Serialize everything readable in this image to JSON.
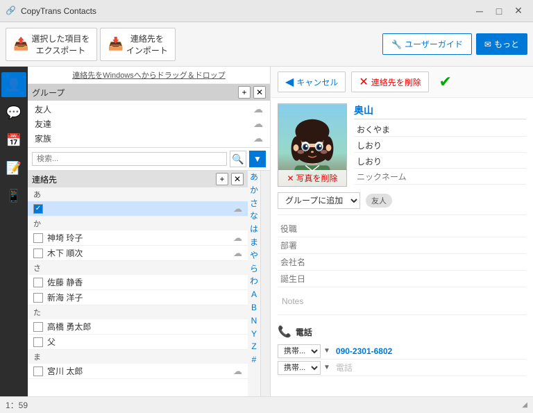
{
  "app": {
    "title": "CopyTrans Contacts",
    "window_controls": {
      "minimize": "─",
      "maximize": "□",
      "close": "✕"
    }
  },
  "toolbar": {
    "export_icon": "📤",
    "export_label_line1": "選択した項目を",
    "export_label_line2": "エクスポート",
    "import_icon": "📥",
    "import_label_line1": "連絡先を",
    "import_label_line2": "インポート",
    "guide_icon": "🔧",
    "guide_label": "ユーザーガイド",
    "more_icon": "✉",
    "more_label": "もっと"
  },
  "drag_hint": "連絡先をWindowsへからドラッグ＆ドロップ",
  "groups": {
    "header": "グループ",
    "add_btn": "+",
    "remove_btn": "✕",
    "items": [
      {
        "name": "友人",
        "cloud": true
      },
      {
        "name": "友達",
        "cloud": true
      },
      {
        "name": "家族",
        "cloud": true
      }
    ]
  },
  "search": {
    "placeholder": "検索...",
    "search_icon": "🔍",
    "filter_icon": "▼"
  },
  "contacts": {
    "header": "連絡先",
    "add_btn": "+",
    "remove_btn": "✕",
    "alpha_index": [
      "あ",
      "か",
      "さ",
      "な",
      "は",
      "ま",
      "や",
      "ら",
      "わ",
      "A",
      "B",
      "N",
      "Y",
      "Z",
      "#"
    ],
    "groups": [
      {
        "label": "あ",
        "items": [
          {
            "name": "",
            "checked": true,
            "cloud": true,
            "selected": true
          }
        ]
      },
      {
        "label": "か",
        "items": [
          {
            "name": "神埼 玲子",
            "checked": false,
            "cloud": true
          },
          {
            "name": "木下 順次",
            "checked": false,
            "cloud": true
          }
        ]
      },
      {
        "label": "さ",
        "items": [
          {
            "name": "佐藤 静香",
            "checked": false,
            "cloud": false
          },
          {
            "name": "新海 洋子",
            "checked": false,
            "cloud": false
          }
        ]
      },
      {
        "label": "た",
        "items": [
          {
            "name": "高橋 勇太郎",
            "checked": false,
            "cloud": false
          },
          {
            "name": "父",
            "checked": false,
            "cloud": false
          }
        ]
      },
      {
        "label": "ま",
        "items": [
          {
            "name": "宮川 太郎",
            "checked": false,
            "cloud": true
          }
        ]
      }
    ]
  },
  "detail": {
    "cancel_label": "キャンセル",
    "delete_label": "連絡先を削除",
    "photo_delete_label": "写真を削除",
    "add_to_group_label": "グループに追加",
    "group_tag": "友人",
    "name_main": "奥山",
    "name_reading": "おくやま",
    "first_name": "しおり",
    "first_name_reading": "しおり",
    "nickname_placeholder": "ニックネーム",
    "role_placeholder": "役職",
    "department_placeholder": "部署",
    "company_placeholder": "会社名",
    "birthday_placeholder": "誕生日",
    "notes_placeholder": "Notes",
    "phone_section_icon": "📞",
    "phone_section_label": "電話",
    "phone_rows": [
      {
        "type": "携帯...",
        "value": "090-2301-6802",
        "has_value": true
      },
      {
        "type": "携帯...",
        "value": "電話",
        "has_value": false
      }
    ]
  },
  "status_bar": {
    "time": "1：59",
    "resize_icon": "◢"
  }
}
